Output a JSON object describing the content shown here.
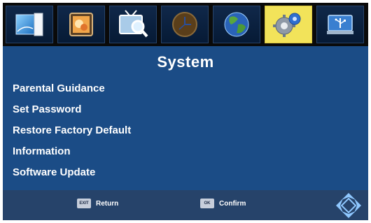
{
  "tabs": [
    {
      "icon": "picture-frame-icon",
      "selected": false
    },
    {
      "icon": "photo-icon",
      "selected": false
    },
    {
      "icon": "tv-search-icon",
      "selected": false
    },
    {
      "icon": "clock-icon",
      "selected": false
    },
    {
      "icon": "globe-icon",
      "selected": false
    },
    {
      "icon": "gears-icon",
      "selected": true
    },
    {
      "icon": "usb-icon",
      "selected": false
    }
  ],
  "title": "System",
  "menu": {
    "items": [
      "Parental Guidance",
      "Set Password",
      "Restore Factory Default",
      "Information",
      "Software Update"
    ]
  },
  "footer": {
    "exit_key": "EXIT",
    "exit_label": "Return",
    "ok_key": "OK",
    "ok_label": "Confirm",
    "nav_icon": "direction-pad-icon"
  },
  "colors": {
    "background": "#1b4c86",
    "topbar": "#0a0a0a",
    "selected_tab": "#f2e35a",
    "footer": "#26436a"
  }
}
